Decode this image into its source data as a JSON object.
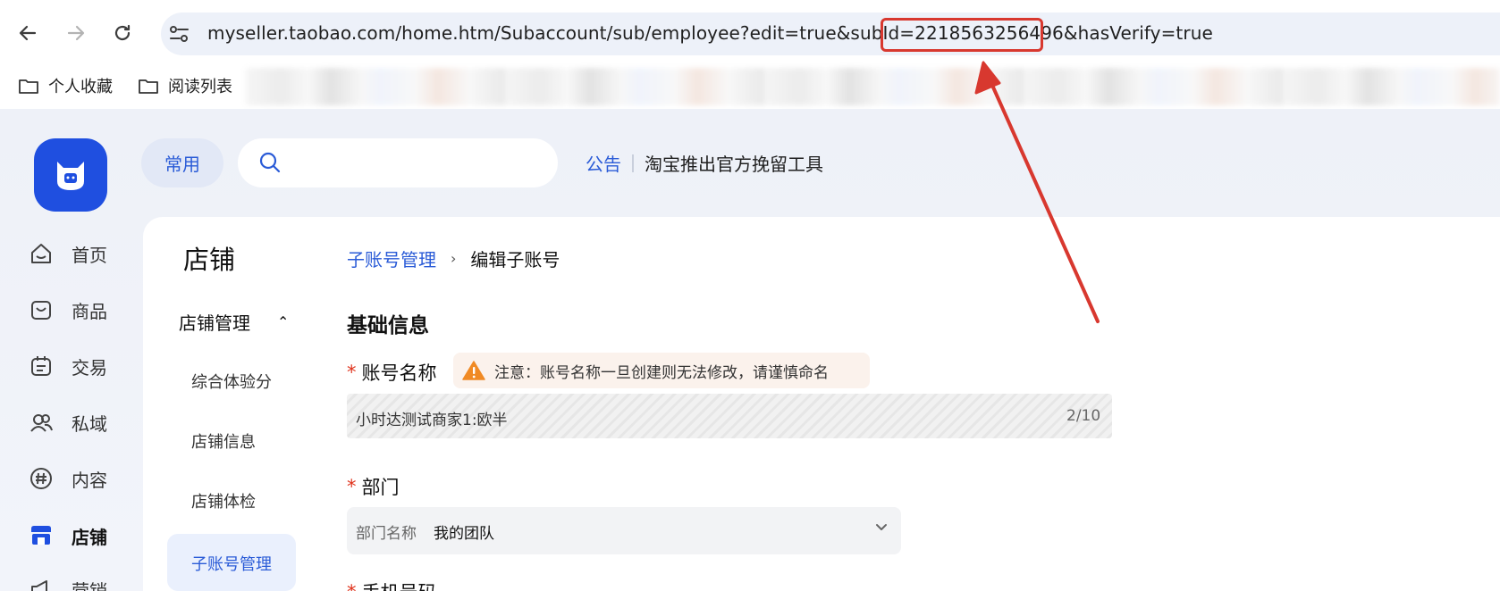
{
  "browser": {
    "url": "myseller.taobao.com/home.htm/Subaccount/sub/employee?edit=true&subId=2218563256496&hasVerify=true",
    "bookmarks": [
      "个人收藏",
      "阅读列表"
    ]
  },
  "header": {
    "frequent_label": "常用",
    "search_placeholder": "",
    "notice_label": "公告",
    "notice_text": "淘宝推出官方挽留工具"
  },
  "left_nav": {
    "items": [
      {
        "label": "首页"
      },
      {
        "label": "商品"
      },
      {
        "label": "交易"
      },
      {
        "label": "私域"
      },
      {
        "label": "内容"
      },
      {
        "label": "店铺"
      },
      {
        "label": "营销"
      }
    ]
  },
  "sub_nav": {
    "section_title": "店铺",
    "group_label": "店铺管理",
    "items": [
      "综合体验分",
      "店铺信息",
      "店铺体检",
      "子账号管理"
    ]
  },
  "breadcrumb": {
    "parent": "子账号管理",
    "current": "编辑子账号"
  },
  "form": {
    "heading": "基础信息",
    "account_name_label": "账号名称",
    "warning_text": "注意：账号名称一旦创建则无法修改，请谨慎命名",
    "account_name_value": "小时达测试商家1:欧半",
    "account_name_count": "2/10",
    "department_label": "部门",
    "department_key": "部门名称",
    "department_value": "我的团队",
    "phone_label": "手机号码"
  },
  "colors": {
    "brand_blue": "#1f4fe0",
    "link_blue": "#2a5bd7",
    "annotation_red": "#d8382f",
    "warning_orange": "#f08a24"
  }
}
